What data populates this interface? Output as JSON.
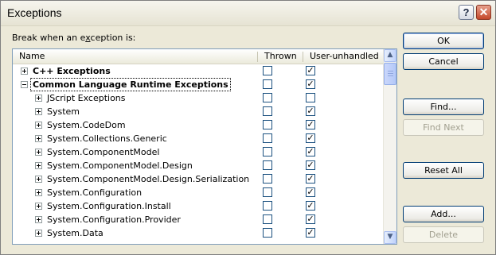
{
  "window": {
    "title": "Exceptions"
  },
  "titlebar": {
    "help_glyph": "?",
    "close_glyph": "✕"
  },
  "prompt": {
    "before": "Break when an e",
    "mnemonic": "x",
    "after": "ception is:"
  },
  "columns": {
    "name": "Name",
    "thrown": "Thrown",
    "unhandled": "User-unhandled"
  },
  "rows": [
    {
      "label": "C++ Exceptions",
      "indent": 0,
      "expander": "plus",
      "bold": true,
      "selected": false,
      "thrown": false,
      "unhandled": true
    },
    {
      "label": "Common Language Runtime Exceptions",
      "indent": 0,
      "expander": "minus",
      "bold": true,
      "selected": true,
      "thrown": false,
      "unhandled": true
    },
    {
      "label": "JScript Exceptions",
      "indent": 1,
      "expander": "plus",
      "bold": false,
      "selected": false,
      "thrown": false,
      "unhandled": false
    },
    {
      "label": "System",
      "indent": 1,
      "expander": "plus",
      "bold": false,
      "selected": false,
      "thrown": false,
      "unhandled": true
    },
    {
      "label": "System.CodeDom",
      "indent": 1,
      "expander": "plus",
      "bold": false,
      "selected": false,
      "thrown": false,
      "unhandled": true
    },
    {
      "label": "System.Collections.Generic",
      "indent": 1,
      "expander": "plus",
      "bold": false,
      "selected": false,
      "thrown": false,
      "unhandled": true
    },
    {
      "label": "System.ComponentModel",
      "indent": 1,
      "expander": "plus",
      "bold": false,
      "selected": false,
      "thrown": false,
      "unhandled": true
    },
    {
      "label": "System.ComponentModel.Design",
      "indent": 1,
      "expander": "plus",
      "bold": false,
      "selected": false,
      "thrown": false,
      "unhandled": true
    },
    {
      "label": "System.ComponentModel.Design.Serialization",
      "indent": 1,
      "expander": "plus",
      "bold": false,
      "selected": false,
      "thrown": false,
      "unhandled": true
    },
    {
      "label": "System.Configuration",
      "indent": 1,
      "expander": "plus",
      "bold": false,
      "selected": false,
      "thrown": false,
      "unhandled": true
    },
    {
      "label": "System.Configuration.Install",
      "indent": 1,
      "expander": "plus",
      "bold": false,
      "selected": false,
      "thrown": false,
      "unhandled": true
    },
    {
      "label": "System.Configuration.Provider",
      "indent": 1,
      "expander": "plus",
      "bold": false,
      "selected": false,
      "thrown": false,
      "unhandled": true
    },
    {
      "label": "System.Data",
      "indent": 1,
      "expander": "plus",
      "bold": false,
      "selected": false,
      "thrown": false,
      "unhandled": true
    }
  ],
  "scrollbar": {
    "up_glyph": "▲",
    "down_glyph": "▼"
  },
  "buttons": {
    "ok": "OK",
    "cancel": "Cancel",
    "find": "Find...",
    "find_next": "Find Next",
    "reset_all": "Reset All",
    "add": "Add...",
    "delete": "Delete"
  },
  "colors": {
    "title_bg": "#f3f2ea",
    "dialog_bg": "#ece9d8",
    "check": "#000000"
  }
}
